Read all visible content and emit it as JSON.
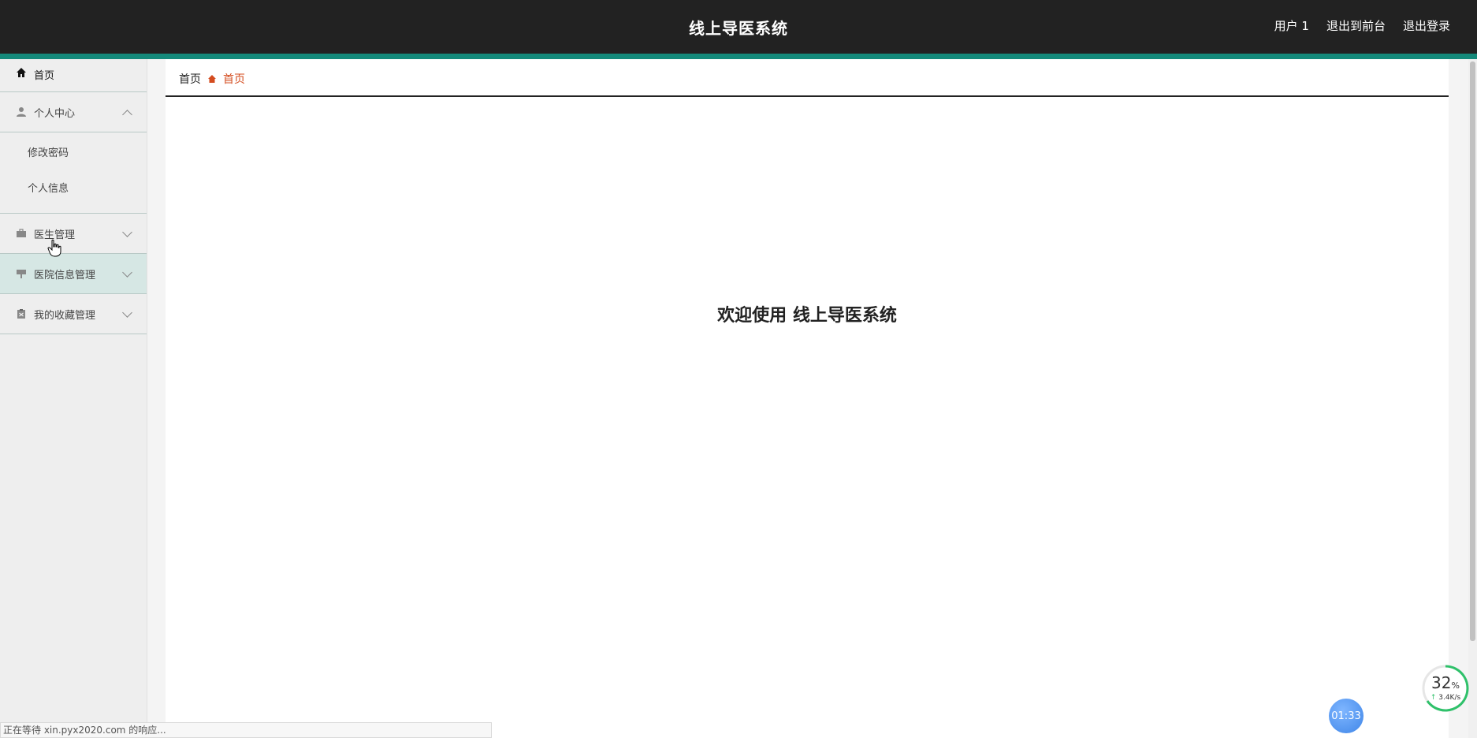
{
  "header": {
    "title": "线上导医系统",
    "links": [
      "用户 1",
      "退出到前台",
      "退出登录"
    ]
  },
  "sidebar": {
    "home": "首页",
    "personal_center": {
      "label": "个人中心",
      "children": [
        "修改密码",
        "个人信息"
      ]
    },
    "groups": [
      "医生管理",
      "医院信息管理",
      "我的收藏管理"
    ]
  },
  "breadcrumb": [
    "首页",
    "首页"
  ],
  "welcome": "欢迎使用 线上导医系统",
  "status_bar": "正在等待 xin.pyx2020.com 的响应...",
  "speed_widget": {
    "percent": "32",
    "percent_unit": "%",
    "rate": "3.4K/s"
  },
  "timer": "01:33",
  "colors": {
    "header_bg": "#222222",
    "accent": "#14897a",
    "breadcrumb_active": "#d44c1f"
  }
}
